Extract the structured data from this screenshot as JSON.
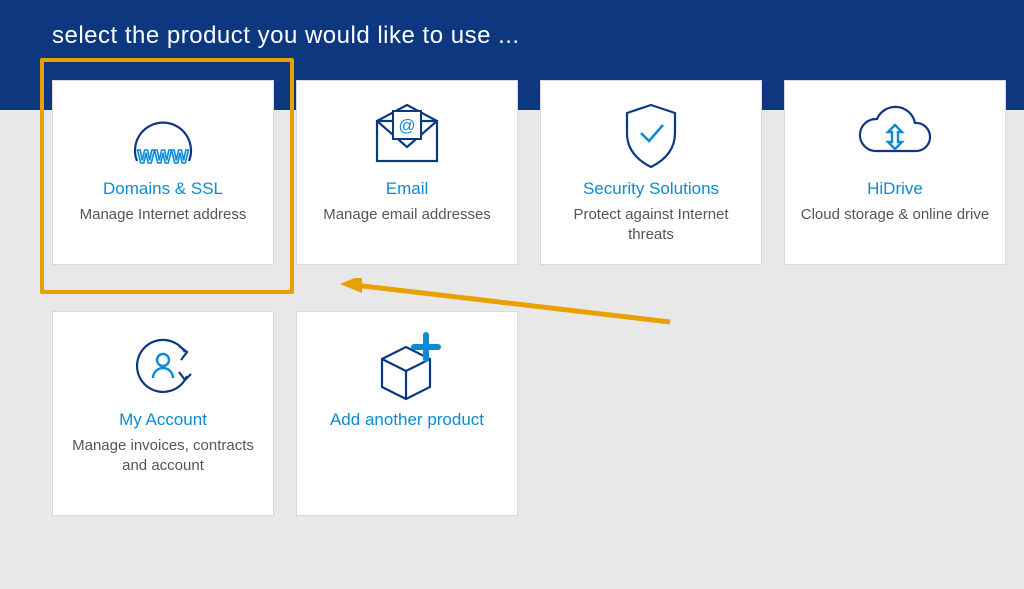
{
  "banner": {
    "title": "select the product you would like to use ..."
  },
  "cards": {
    "domains": {
      "title": "Domains & SSL",
      "desc": "Manage Internet address"
    },
    "email": {
      "title": "Email",
      "desc": "Manage email addresses"
    },
    "security": {
      "title": "Security Solutions",
      "desc": "Protect against Internet threats"
    },
    "hidrive": {
      "title": "HiDrive",
      "desc": "Cloud storage & online drive"
    },
    "account": {
      "title": "My Account",
      "desc": "Manage invoices, contracts and account"
    },
    "addprod": {
      "title": "Add another product",
      "desc": ""
    }
  },
  "colors": {
    "accent": "#0b8bd4",
    "banner": "#0d3880",
    "highlight": "#e7a100"
  }
}
